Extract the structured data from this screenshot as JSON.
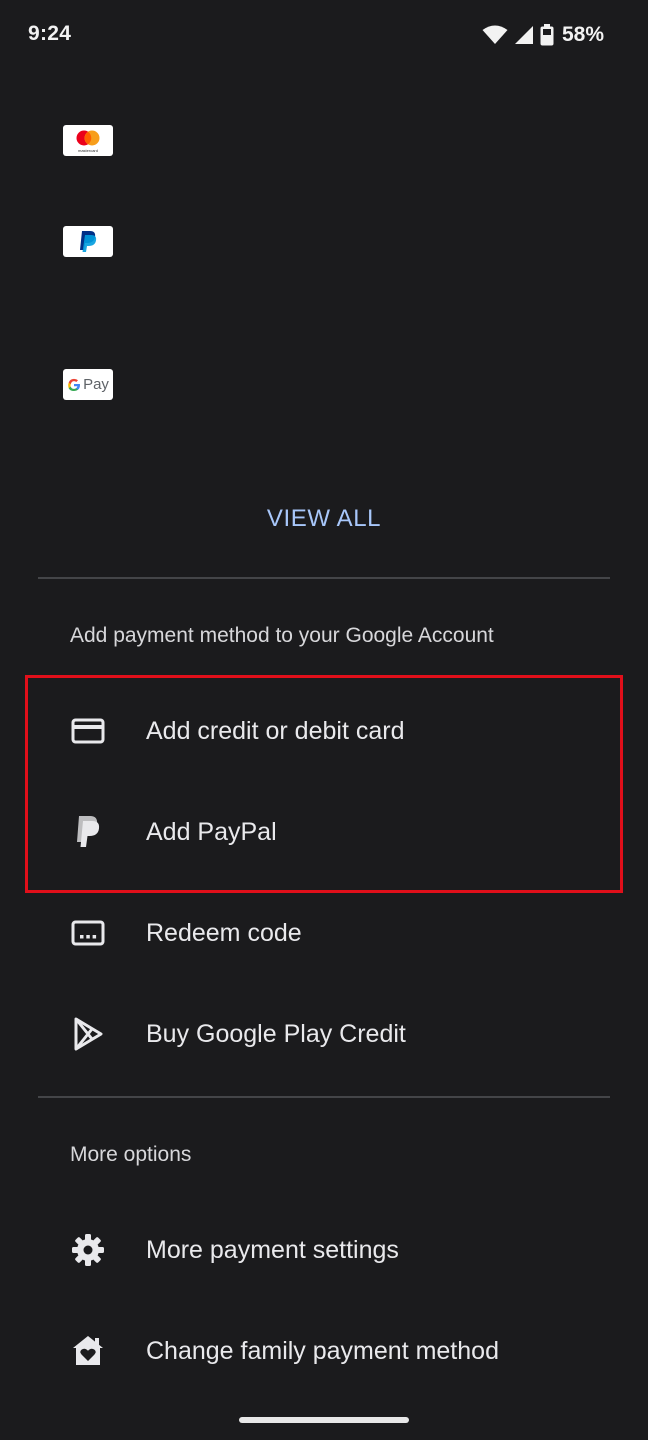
{
  "status_bar": {
    "time": "9:24",
    "battery": "58%"
  },
  "payment_logos": [
    {
      "name": "mastercard",
      "caption": "mastercard"
    },
    {
      "name": "paypal"
    },
    {
      "name": "gpay",
      "text": "Pay"
    }
  ],
  "view_all_label": "VIEW ALL",
  "add_section": {
    "header": "Add payment method to your Google Account",
    "items": [
      {
        "label": "Add credit or debit card",
        "icon": "credit-card-icon"
      },
      {
        "label": "Add PayPal",
        "icon": "paypal-icon"
      },
      {
        "label": "Redeem code",
        "icon": "redeem-code-icon"
      },
      {
        "label": "Buy Google Play Credit",
        "icon": "play-icon"
      }
    ]
  },
  "more_section": {
    "header": "More options",
    "items": [
      {
        "label": "More payment settings",
        "icon": "gear-icon"
      },
      {
        "label": "Change family payment method",
        "icon": "family-home-icon"
      }
    ]
  },
  "colors": {
    "background": "#1b1b1d",
    "accent_link": "#a8c7fa",
    "highlight_border": "#e10f1a"
  }
}
